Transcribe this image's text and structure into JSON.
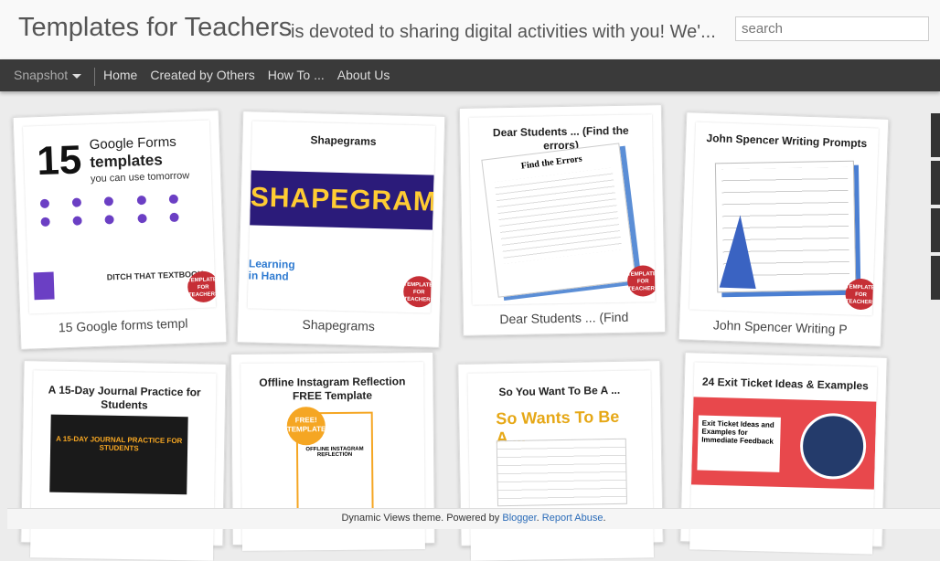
{
  "header": {
    "title": "Templates for Teachers",
    "description": "is devoted to sharing digital activities with you! We'...",
    "search_placeholder": "search"
  },
  "nav": {
    "view": "Snapshot",
    "links": [
      "Home",
      "Created by Others",
      "How To ...",
      "About Us"
    ]
  },
  "cards": [
    {
      "title": "15 Google forms templ",
      "image_text": {
        "number": "15",
        "line1": "Google Forms",
        "line2": "templates",
        "line3": "you can use tomorrow",
        "brand": "DITCH THAT TEXTBOOK"
      }
    },
    {
      "title": "Shapegrams",
      "image_text": {
        "heading": "Shapegrams",
        "banner": "SHAPEGRAMS",
        "tag": "Learning in Hand"
      }
    },
    {
      "title": "Dear Students ... (Find",
      "image_text": {
        "heading": "Dear Students ... (Find the errors)",
        "doc": "Find the Errors"
      }
    },
    {
      "title": "John Spencer Writing P",
      "image_text": {
        "heading": "John Spencer Writing Prompts"
      }
    },
    {
      "title": "",
      "image_text": {
        "heading": "A 15-Day Journal Practice for Students",
        "banner": "A 15-DAY JOURNAL PRACTICE FOR STUDENTS"
      }
    },
    {
      "title": "",
      "image_text": {
        "heading": "Offline Instagram Reflection FREE Template",
        "sticker": "FREE! TEMPLATE",
        "doc": "OFFLINE INSTAGRAM REFLECTION"
      }
    },
    {
      "title": "",
      "image_text": {
        "heading": "So You Want To Be A ...",
        "banner": "So Wants To Be A ..."
      }
    },
    {
      "title": "",
      "image_text": {
        "heading": "24 Exit Ticket Ideas & Examples",
        "doc": "Exit Ticket Ideas and Examples for Immediate Feedback"
      }
    }
  ],
  "badge_text": "TEMPLATES FOR TEACHERS",
  "footer": {
    "prefix": "Dynamic Views theme. Powered by ",
    "blogger": "Blogger",
    "sep": ". ",
    "report": "Report Abuse",
    "suffix": "."
  },
  "colors": {
    "nav_bg": "#3a3a3a",
    "header_bg": "#f9f9f9",
    "badge": "#c62f36",
    "link": "#2a6bb8",
    "shapegrams_bg": "#2b1b7a"
  }
}
